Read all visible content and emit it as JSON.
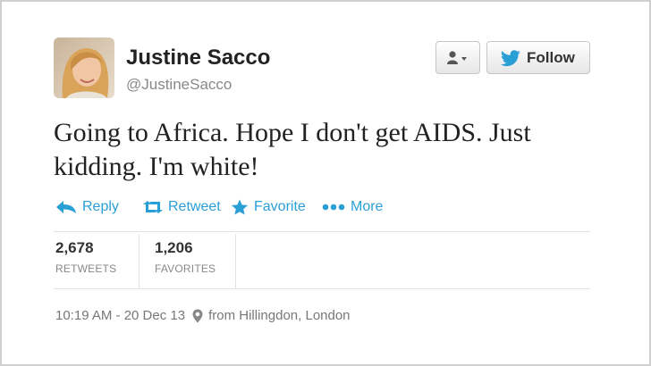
{
  "author": {
    "name": "Justine Sacco",
    "handle": "@JustineSacco"
  },
  "buttons": {
    "user_menu_icon": "user-dropdown-icon",
    "follow_label": "Follow",
    "follow_icon": "twitter-bird-icon"
  },
  "tweet": {
    "text": "Going to Africa. Hope I don't get AIDS. Just kidding. I'm white!"
  },
  "actions": {
    "reply": "Reply",
    "retweet": "Retweet",
    "favorite": "Favorite",
    "more": "More"
  },
  "stats": {
    "retweets_count": "2,678",
    "retweets_label": "RETWEETS",
    "favorites_count": "1,206",
    "favorites_label": "FAVORITES"
  },
  "meta": {
    "timestamp": "10:19 AM - 20 Dec 13",
    "location": "from Hillingdon, London"
  },
  "colors": {
    "accent": "#2a9fd6",
    "text": "#222222",
    "muted": "#888888"
  }
}
